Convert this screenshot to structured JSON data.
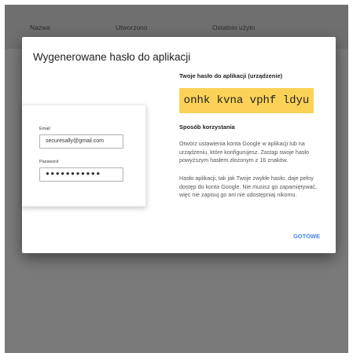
{
  "table": {
    "columns": [
      "Nazwa",
      "Utworzono",
      "Ostatnio użyto"
    ]
  },
  "dialog": {
    "title": "Wygenerowane hasło do aplikacji",
    "password_heading": "Twoje hasło do aplikacji (urządzenie)",
    "password": "onhk kvna vphf ldyu",
    "usage_heading": "Sposób korzystania",
    "usage_paragraph_1": "Otwórz ustawienia konta Google w aplikacji lub na urządzeniu, które konfigurujesz. Zastąp swoje hasło powyższym hasłem złożonym z 16 znaków.",
    "usage_paragraph_2": "Hasło aplikacji, tak jak Twoje zwykłe hasło, daje pełny dostęp do konta Google. Nie musisz go zapamiętywać, więc nie zapisuj go ani nie udostępniaj nikomu.",
    "done_label": "GOTOWE"
  },
  "example_form": {
    "email_label": "Email",
    "email_value": "securesally@gmail.com",
    "password_label": "Password",
    "password_value": "●●●●●●●●●●●"
  },
  "colors": {
    "backdrop": "#7a7a7a",
    "password_highlight": "#fbd257",
    "accent": "#4285f4"
  }
}
